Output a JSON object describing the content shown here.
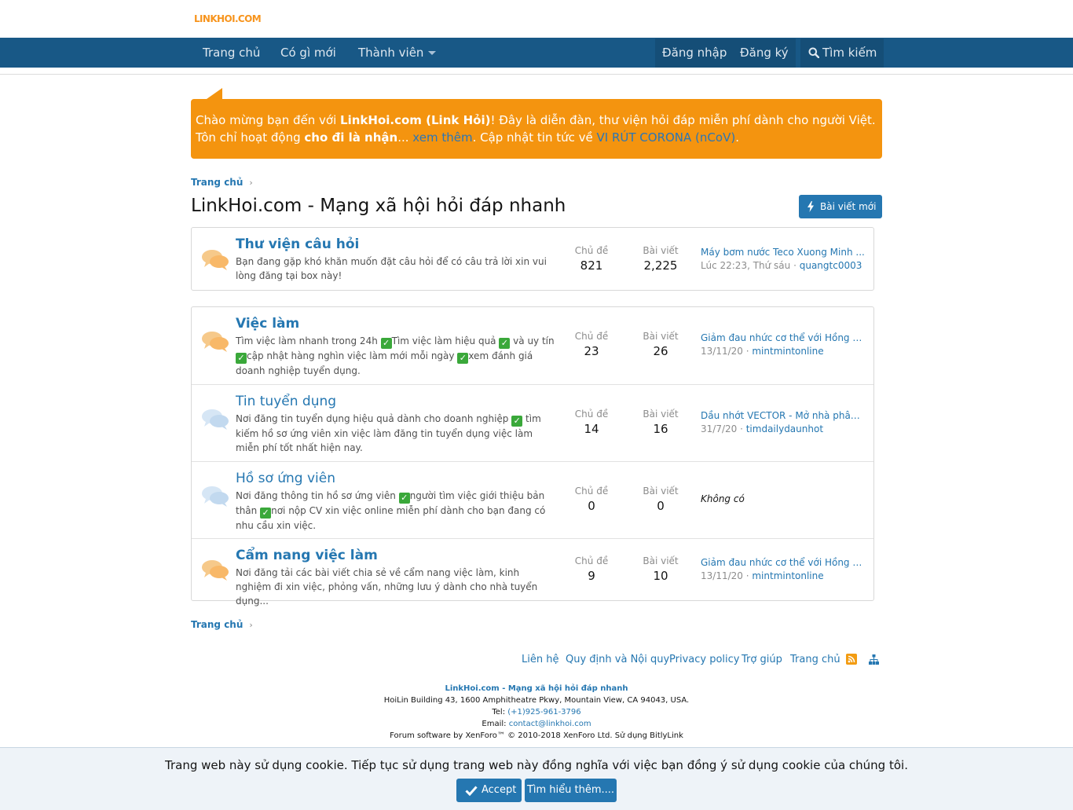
{
  "site": {
    "logo": "LINKHOI.COM"
  },
  "nav": {
    "items": [
      "Trang chủ",
      "Có gì mới",
      "Thành viên"
    ],
    "login": "Đăng nhập",
    "register": "Đăng ký",
    "search": "Tìm kiếm"
  },
  "notice": {
    "p1": "Chào mừng bạn đến với ",
    "brand": "LinkHoi.com (Link Hỏi)",
    "p2": "! Đây là diễn đàn, thư viện hỏi đáp miễn phí dành cho người Việt. Tôn chỉ hoạt động ",
    "motto": "cho đi là nhận",
    "p3": "... ",
    "more": "xem thêm",
    "p4": ". Cập nhật tin tức về ",
    "corona": "VI RÚT CORONA (nCoV)",
    "p5": "."
  },
  "breadcrumb": {
    "home": "Trang chủ"
  },
  "page": {
    "title": "LinkHoi.com - Mạng xã hội hỏi đáp nhanh",
    "new_post": "Bài viết mới"
  },
  "labels": {
    "threads": "Chủ đề",
    "posts": "Bài viết"
  },
  "forums": [
    {
      "title": "Thư viện câu hỏi",
      "desc": "Bạn đang gặp khó khăn muốn đặt câu hỏi để có câu trả lời xin vui lòng đăng tại box này!",
      "threads": "821",
      "posts": "2,225",
      "last_title": "Máy bơm nước Teco Xuong Minh ...",
      "last_date": "Lúc 22:23, Thứ sáu",
      "last_user": "quangtc0003"
    },
    {
      "title": "Việc làm",
      "desc_parts": [
        "Tìm việc làm nhanh trong 24h ",
        "Tìm việc làm hiệu quả ",
        " và uy tín ",
        "cập nhật hàng nghìn việc làm mới mỗi ngày ",
        "xem đánh giá doanh nghiệp tuyển dụng."
      ],
      "threads": "23",
      "posts": "26",
      "last_title": "Giảm đau nhức cơ thể với Hồng q...",
      "last_date": "13/11/20",
      "last_user": "mintmintonline"
    },
    {
      "title": "Tin tuyển dụng",
      "desc_parts": [
        "Nơi đăng tin tuyển dụng hiệu quả dành cho doanh nghiệp ",
        " tìm kiếm hồ sơ ứng viên xin việc làm đăng tin tuyển dụng việc làm miễn phí tốt nhất hiện nay."
      ],
      "threads": "14",
      "posts": "16",
      "last_title": "Dầu nhớt VECTOR - Mở nhà phân ...",
      "last_date": "31/7/20",
      "last_user": "timdailydaunhot"
    },
    {
      "title": "Hồ sơ ứng viên",
      "desc_parts": [
        "Nơi đăng thông tin hồ sơ ứng viên ",
        "người tìm việc giới thiệu bản thân ",
        "nơi nộp CV xin việc online miễn phí dành cho bạn đang có nhu cầu xin việc."
      ],
      "threads": "0",
      "posts": "0",
      "last_none": "Không có"
    },
    {
      "title": "Cẩm nang việc làm",
      "desc": "Nơi đăng tải các bài viết chia sẻ về cẩm nang việc làm, kinh nghiệm đi xin việc, phỏng vấn, những lưu ý dành cho nhà tuyển dụng...",
      "threads": "9",
      "posts": "10",
      "last_title": "Giảm đau nhức cơ thể với Hồng q...",
      "last_date": "13/11/20",
      "last_user": "mintmintonline"
    }
  ],
  "footer": {
    "links": [
      "Liên hệ",
      "Quy định và Nội quy",
      "Privacy policy",
      "Trợ giúp",
      "Trang chủ"
    ],
    "line1": "LinkHoi.com - Mạng xã hội hỏi đáp nhanh",
    "line2": "HoiLin Building 43, 1600 Amphitheatre Pkwy, Mountain View, CA 94043, USA.",
    "tel_label": "Tel: ",
    "tel": "(+1)925-961-3796",
    "email_label": "Email: ",
    "email": "contact@linkhoi.com",
    "line5": "Forum software by XenForo™ © 2010-2018 XenForo Ltd. Sử dụng BitlyLink"
  },
  "cookie": {
    "text": "Trang web này sử dụng cookie. Tiếp tục sử dụng trang web này đồng nghĩa với việc bạn đồng ý sử dụng cookie của chúng tôi.",
    "accept": "Accept",
    "learn": "Tìm hiểu thêm...."
  },
  "colors": {
    "nav": "#185886",
    "accent": "#2577b1",
    "notice": "#f4940f",
    "check": "#3aa83a"
  },
  "icons": [
    "search-icon",
    "bolt-icon",
    "chat-bubbles-icon",
    "checkmark-icon",
    "rss-icon",
    "sitemap-icon"
  ]
}
